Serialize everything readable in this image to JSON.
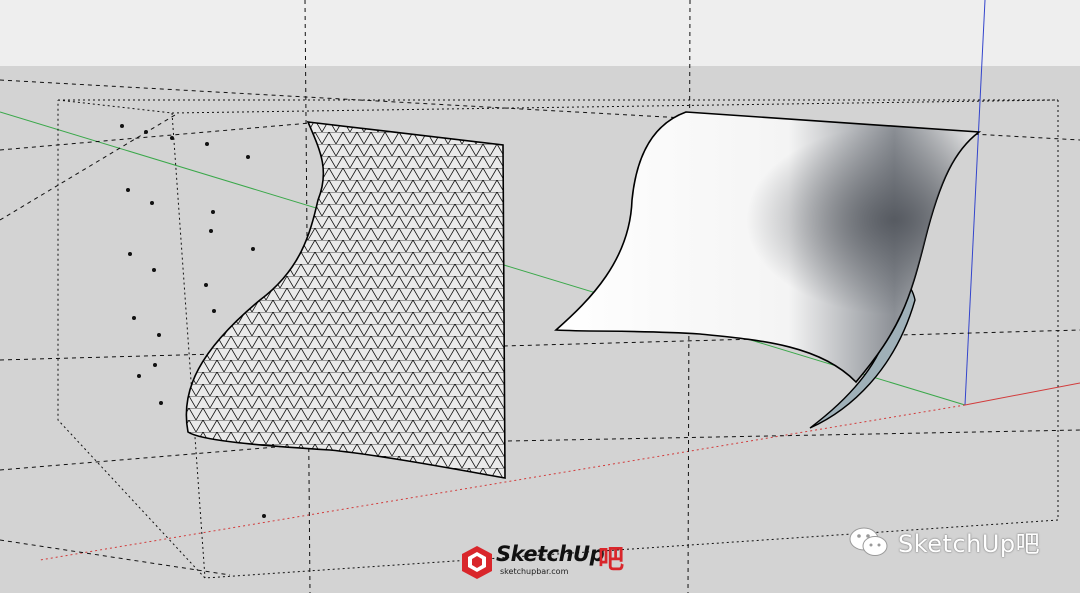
{
  "colors": {
    "background": "#d3d3d3",
    "sky": "#eeeeee",
    "ground": "#d3d3d3",
    "axis_red": "#d23b3b",
    "axis_green": "#3aa84a",
    "axis_blue": "#3344cc",
    "guide_line": "#111111",
    "mesh_line": "#111111",
    "surface_light": "#ffffff",
    "surface_shadow": "#5a5f66",
    "surface_back": "#9fb0b8",
    "logo_red": "#d9262b"
  },
  "icons": {
    "logo": "sketchup-box-icon",
    "wechat": "wechat-icon"
  },
  "watermark": {
    "label": "SketchUp吧"
  },
  "logo": {
    "word": "SketchUp",
    "suffix": "吧",
    "url": "sketchupbar.com"
  }
}
